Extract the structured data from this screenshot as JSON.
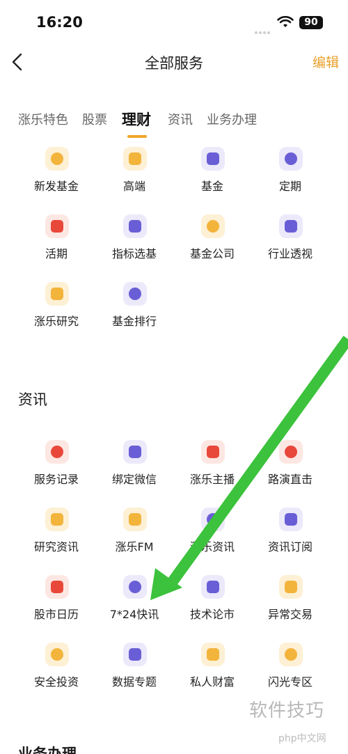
{
  "status": {
    "time": "16:20",
    "battery": "90"
  },
  "nav": {
    "title": "全部服务",
    "edit": "编辑"
  },
  "tabs": [
    {
      "label": "涨乐特色"
    },
    {
      "label": "股票"
    },
    {
      "label": "理财"
    },
    {
      "label": "资讯"
    },
    {
      "label": "业务办理"
    }
  ],
  "licai": {
    "items": [
      {
        "label": "新发基金",
        "icon": "new-fund-icon",
        "tone": "yellow"
      },
      {
        "label": "高端",
        "icon": "diamond-icon",
        "tone": "yellow"
      },
      {
        "label": "基金",
        "icon": "fund-icon",
        "tone": "purple"
      },
      {
        "label": "定期",
        "icon": "clock-icon",
        "tone": "purple"
      },
      {
        "label": "活期",
        "icon": "yuan-coin-icon",
        "tone": "red"
      },
      {
        "label": "指标选基",
        "icon": "indicator-icon",
        "tone": "purple"
      },
      {
        "label": "基金公司",
        "icon": "building-icon",
        "tone": "yellow"
      },
      {
        "label": "行业透视",
        "icon": "industry-chart-icon",
        "tone": "purple"
      },
      {
        "label": "涨乐研究",
        "icon": "book-icon",
        "tone": "yellow"
      },
      {
        "label": "基金排行",
        "icon": "ranking-icon",
        "tone": "purple"
      }
    ]
  },
  "zixun": {
    "title": "资讯",
    "items": [
      {
        "label": "服务记录",
        "icon": "heart-icon",
        "tone": "red"
      },
      {
        "label": "绑定微信",
        "icon": "wechat-icon",
        "tone": "purple"
      },
      {
        "label": "涨乐主播",
        "icon": "pen-icon",
        "tone": "red"
      },
      {
        "label": "路演直击",
        "icon": "trend-icon",
        "tone": "red"
      },
      {
        "label": "研究资讯",
        "icon": "document-icon",
        "tone": "yellow"
      },
      {
        "label": "涨乐FM",
        "icon": "radio-icon",
        "tone": "yellow"
      },
      {
        "label": "涨乐资讯",
        "icon": "news-icon",
        "tone": "purple"
      },
      {
        "label": "资讯订阅",
        "icon": "bookmark-icon",
        "tone": "purple"
      },
      {
        "label": "股市日历",
        "icon": "calendar-icon",
        "tone": "red"
      },
      {
        "label": "7*24快讯",
        "icon": "flash-news-icon",
        "tone": "purple"
      },
      {
        "label": "技术论市",
        "icon": "edit-icon",
        "tone": "purple"
      },
      {
        "label": "异常交易",
        "icon": "alert-icon",
        "tone": "yellow"
      },
      {
        "label": "安全投资",
        "icon": "shield-yuan-icon",
        "tone": "yellow"
      },
      {
        "label": "数据专题",
        "icon": "data-chart-icon",
        "tone": "purple"
      },
      {
        "label": "私人财富",
        "icon": "pot-icon",
        "tone": "yellow"
      },
      {
        "label": "闪光专区",
        "icon": "star-icon",
        "tone": "yellow"
      }
    ]
  },
  "next_section": {
    "title": "业务办理"
  },
  "watermark": {
    "text": "软件技巧",
    "site": "php中文网"
  },
  "colors": {
    "accent": "#f0a627",
    "arrow": "#3cc23c"
  }
}
